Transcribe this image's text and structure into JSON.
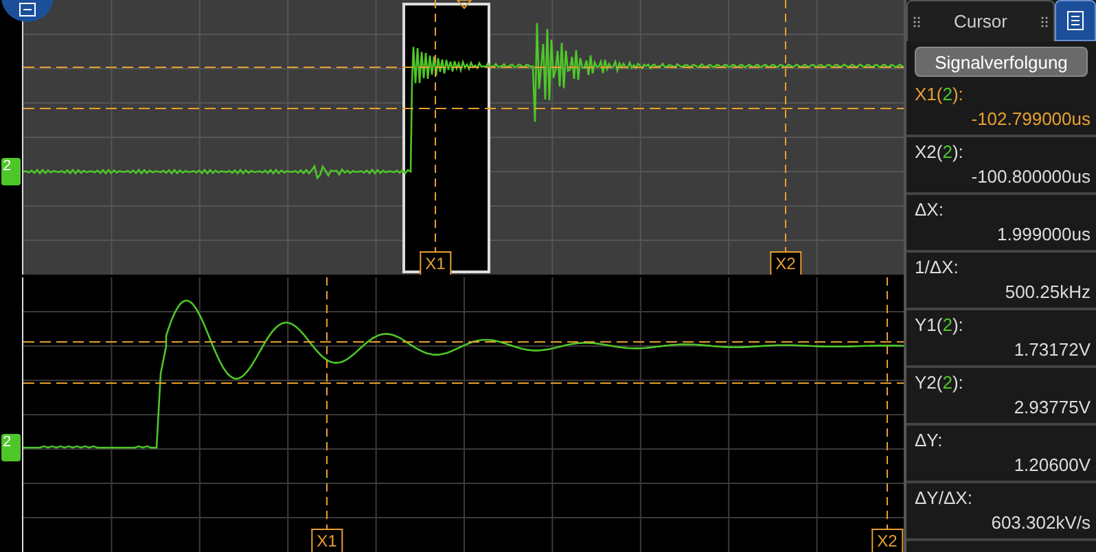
{
  "overview": {
    "channel": "2",
    "cursor_tags": [
      {
        "label": "X1"
      },
      {
        "label": "X2"
      }
    ]
  },
  "zoom_view": {
    "channel": "2",
    "cursor_tags": [
      {
        "label": "X1"
      },
      {
        "label": "X2"
      }
    ]
  },
  "panel": {
    "tab": "Cursor",
    "button": "Signalverfolgung",
    "readings": [
      {
        "label": "X1(",
        "source": "2",
        "suffix": "):",
        "value": "-102.799000us",
        "selected": true
      },
      {
        "label": "X2(",
        "source": "2",
        "suffix": "):",
        "value": "-100.800000us",
        "selected": false
      },
      {
        "label": "ΔX:",
        "value": "1.999000us",
        "selected": false
      },
      {
        "label": "1/ΔX:",
        "value": "500.25kHz",
        "selected": false
      },
      {
        "label": "Y1(",
        "source": "2",
        "suffix": "):",
        "value": "1.73172V",
        "selected": false
      },
      {
        "label": "Y2(",
        "source": "2",
        "suffix": "):",
        "value": "2.93775V",
        "selected": false
      },
      {
        "label": "ΔY:",
        "value": "1.20600V",
        "selected": false
      },
      {
        "label": "ΔY/ΔX:",
        "value": "603.302kV/s",
        "selected": false
      }
    ]
  }
}
